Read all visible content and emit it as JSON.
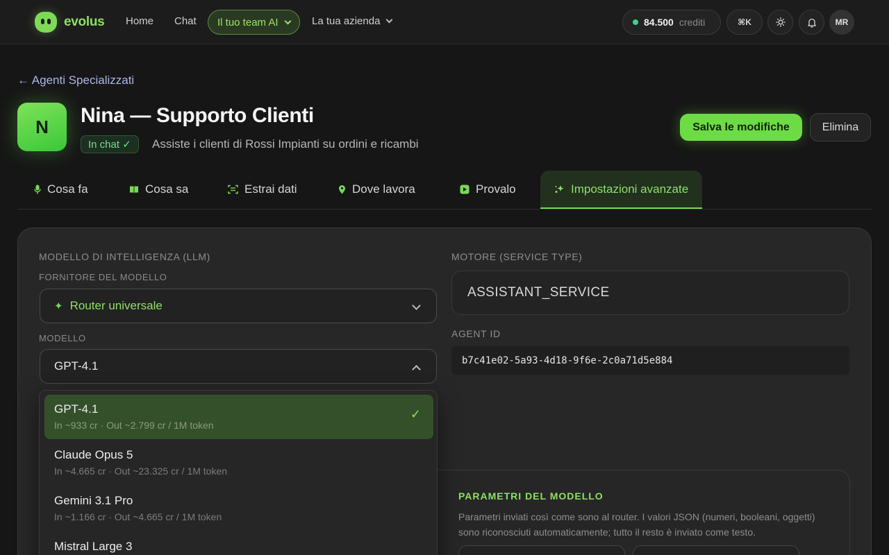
{
  "nav": {
    "brand": "evolus",
    "links": [
      "Home",
      "Chat"
    ],
    "team_pill": "Il tuo team AI",
    "company": "La tua azienda",
    "credits_value": "84.500",
    "credits_unit": "crediti",
    "shortcut": "⌘K",
    "avatar": "MR"
  },
  "header": {
    "back": "← Agenti Specializzati",
    "initial": "N",
    "title": "Nina — Supporto Clienti",
    "status": "In chat ✓",
    "subtitle": "Assiste i clienti di Rossi Impianti su ordini e ricambi",
    "save": "Salva le modifiche",
    "delete": "Elimina"
  },
  "tabs": [
    {
      "label": "Cosa fa",
      "icon": "mic-icon"
    },
    {
      "label": "Cosa sa",
      "icon": "book-icon"
    },
    {
      "label": "Estrai dati",
      "icon": "scan-icon"
    },
    {
      "label": "Dove lavora",
      "icon": "pin-icon"
    },
    {
      "label": "Provalo",
      "icon": "play-icon"
    },
    {
      "label": "Impostazioni avanzate",
      "icon": "sparkle-icon"
    }
  ],
  "llm": {
    "section": "MODELLO DI INTELLIGENZA (LLM)",
    "provider_label": "FORNITORE DEL MODELLO",
    "provider": "Router universale",
    "model_label": "MODELLO",
    "model": "GPT-4.1"
  },
  "engine": {
    "section": "MOTORE (SERVICE TYPE)",
    "value": "ASSISTANT_SERVICE",
    "agent_id_label": "AGENT ID",
    "agent_id": "b7c41e02-5a93-4d18-9f6e-2c0a71d5e884"
  },
  "models": [
    {
      "name": "GPT-4.1",
      "price": "In ~933 cr · Out ~2.799 cr / 1M token",
      "selected": true
    },
    {
      "name": "Claude Opus 5",
      "price": "In ~4.665 cr · Out ~23.325 cr / 1M token",
      "selected": false
    },
    {
      "name": "Gemini 3.1 Pro",
      "price": "In ~1.166 cr · Out ~4.665 cr / 1M token",
      "selected": false
    },
    {
      "name": "Mistral Large 3",
      "price": "",
      "selected": false
    }
  ],
  "params": {
    "title": "PARAMETRI DEL MODELLO",
    "desc": "Parametri inviati così come sono al router. I valori JSON (numeri, booleani, oggetti) sono riconosciuti automaticamente; tutto il resto è inviato come testo."
  },
  "colors": {
    "accent": "#7ed957",
    "background": "#161616",
    "panel": "#272727"
  }
}
